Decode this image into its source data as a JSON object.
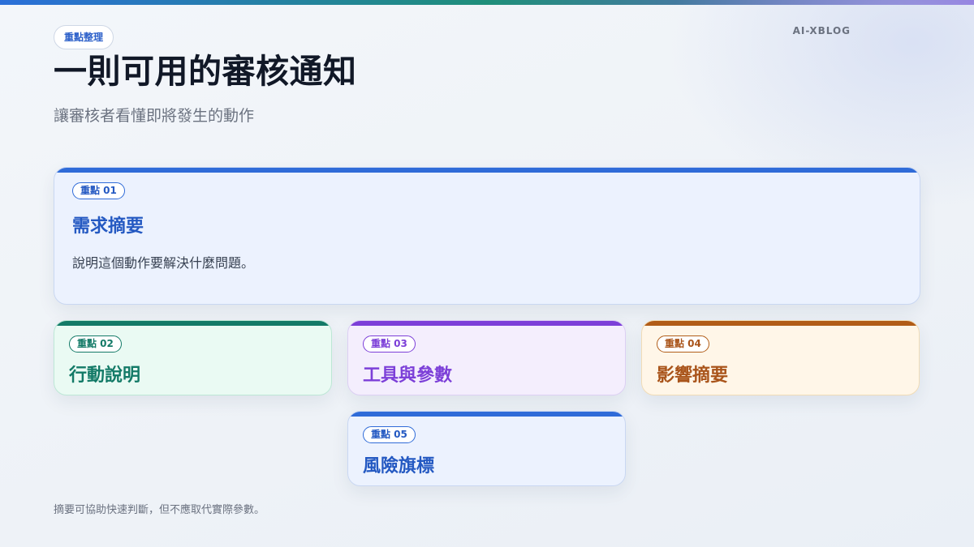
{
  "brand": "AI-XBLOG",
  "header": {
    "pill": "重點整理",
    "title": "一則可用的審核通知",
    "subtitle": "讓審核者看懂即將發生的動作"
  },
  "cards": [
    {
      "badge": "重點 01",
      "title": "需求摘要",
      "desc": "說明這個動作要解決什麼問題。",
      "accent": "#2f6bd8"
    },
    {
      "badge": "重點 02",
      "title": "行動說明",
      "accent": "#137a67"
    },
    {
      "badge": "重點 03",
      "title": "工具與參數",
      "accent": "#7c3fd8"
    },
    {
      "badge": "重點 04",
      "title": "影響摘要",
      "accent": "#b15c17"
    },
    {
      "badge": "重點 05",
      "title": "風險旗標",
      "accent": "#2f6bd8"
    }
  ],
  "footer": "摘要可協助快速判斷，但不應取代實際參數。",
  "colors": {
    "top_gradient": [
      "#2b6fd9",
      "#1f8f7a",
      "#7c5ad9"
    ]
  }
}
